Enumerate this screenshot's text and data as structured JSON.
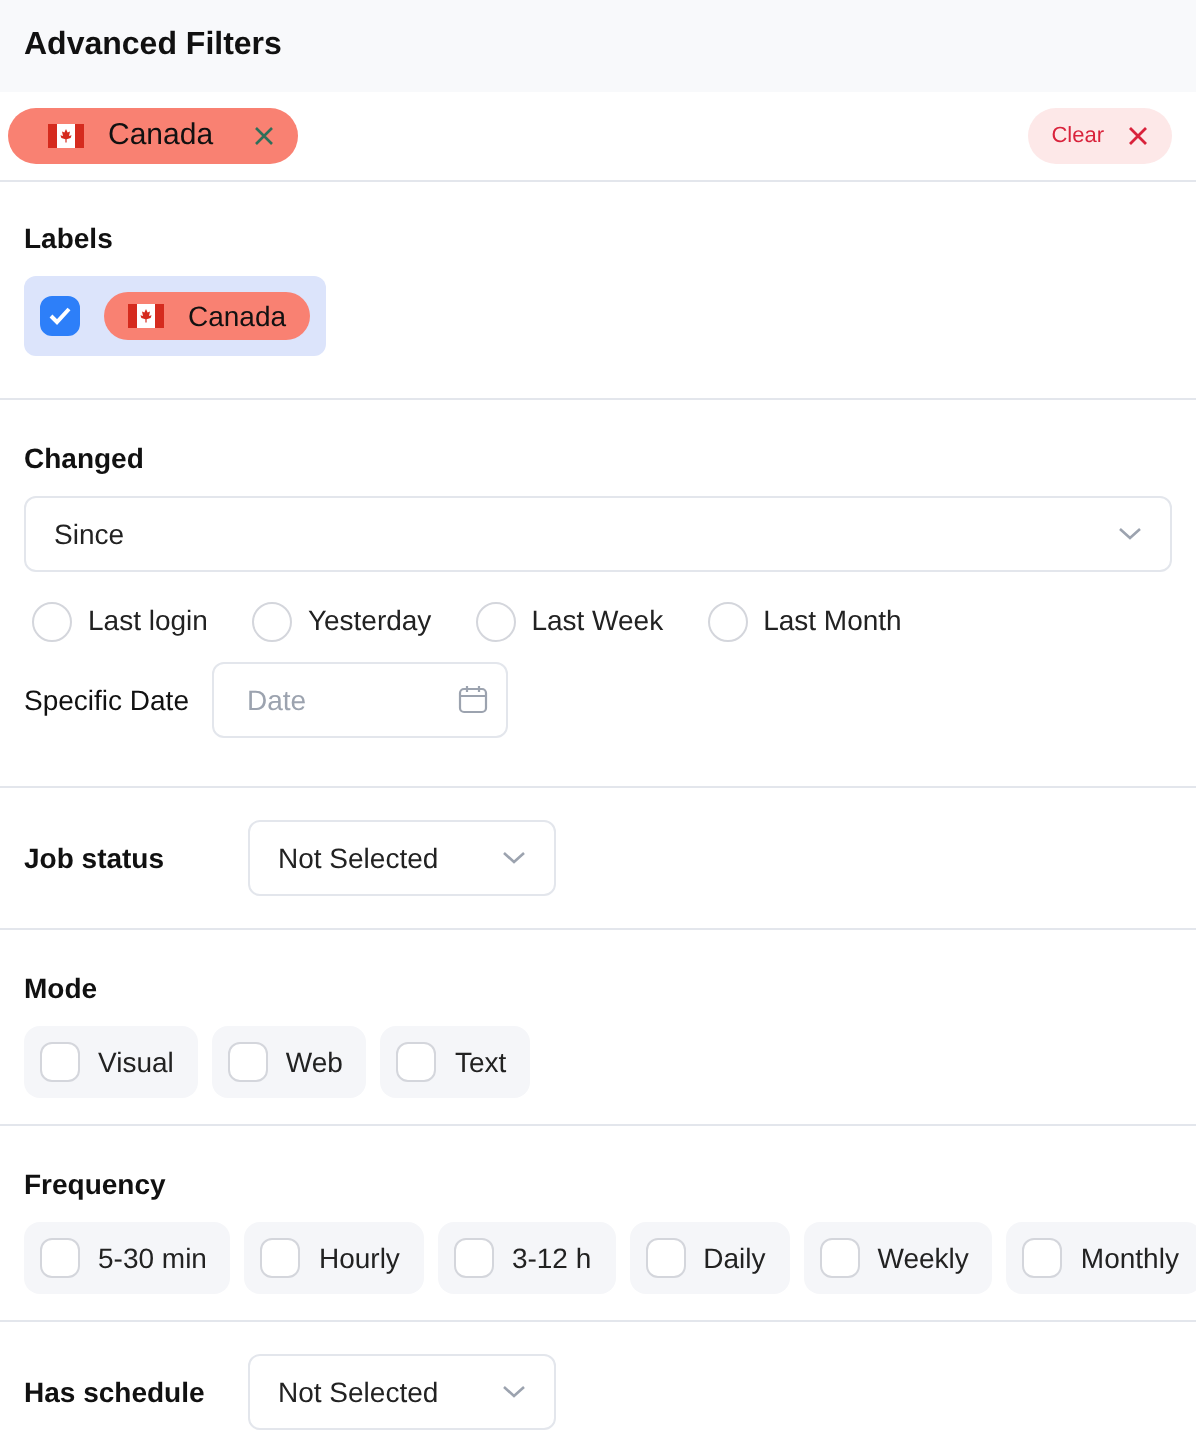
{
  "title": "Advanced Filters",
  "active_filters": [
    {
      "label": "Canada",
      "color": "#f98172"
    }
  ],
  "clear_button": {
    "label": "Clear"
  },
  "labels": {
    "heading": "Labels",
    "items": [
      {
        "label": "Canada",
        "checked": true,
        "color": "#f98172"
      }
    ]
  },
  "changed": {
    "heading": "Changed",
    "select": {
      "value": "Since"
    },
    "options": [
      {
        "label": "Last login",
        "selected": false
      },
      {
        "label": "Yesterday",
        "selected": false
      },
      {
        "label": "Last Week",
        "selected": false
      },
      {
        "label": "Last Month",
        "selected": false
      }
    ],
    "specific_date": {
      "label": "Specific Date",
      "placeholder": "Date"
    }
  },
  "job_status": {
    "label": "Job status",
    "value": "Not Selected"
  },
  "mode": {
    "heading": "Mode",
    "options": [
      {
        "label": "Visual",
        "checked": false
      },
      {
        "label": "Web",
        "checked": false
      },
      {
        "label": "Text",
        "checked": false
      }
    ]
  },
  "frequency": {
    "heading": "Frequency",
    "options": [
      {
        "label": "5-30 min",
        "checked": false
      },
      {
        "label": "Hourly",
        "checked": false
      },
      {
        "label": "3-12 h",
        "checked": false
      },
      {
        "label": "Daily",
        "checked": false
      },
      {
        "label": "Weekly",
        "checked": false
      },
      {
        "label": "Monthly",
        "checked": false
      }
    ]
  },
  "has_schedule": {
    "label": "Has schedule",
    "value": "Not Selected"
  }
}
